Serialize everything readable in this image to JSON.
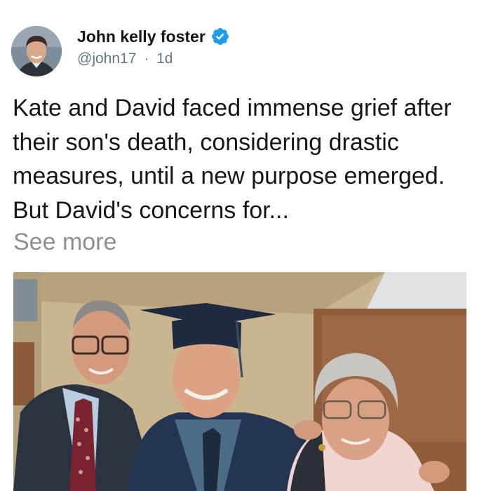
{
  "tweet": {
    "author_name": "John kelly foster",
    "handle": "@john17",
    "separator": "·",
    "timestamp": "1d",
    "verified": true,
    "text": "Kate and David faced immense grief after their son's death, considering drastic measures, until a new purpose emerged. But David's concerns for...",
    "see_more_label": "See more"
  },
  "icons": {
    "avatar": "profile-photo",
    "verified": "verified-badge-icon"
  },
  "colors": {
    "verified_blue": "#1d9bf0",
    "meta_gray": "#657786",
    "see_more_gray": "#8a8f94",
    "text": "#14171a"
  }
}
